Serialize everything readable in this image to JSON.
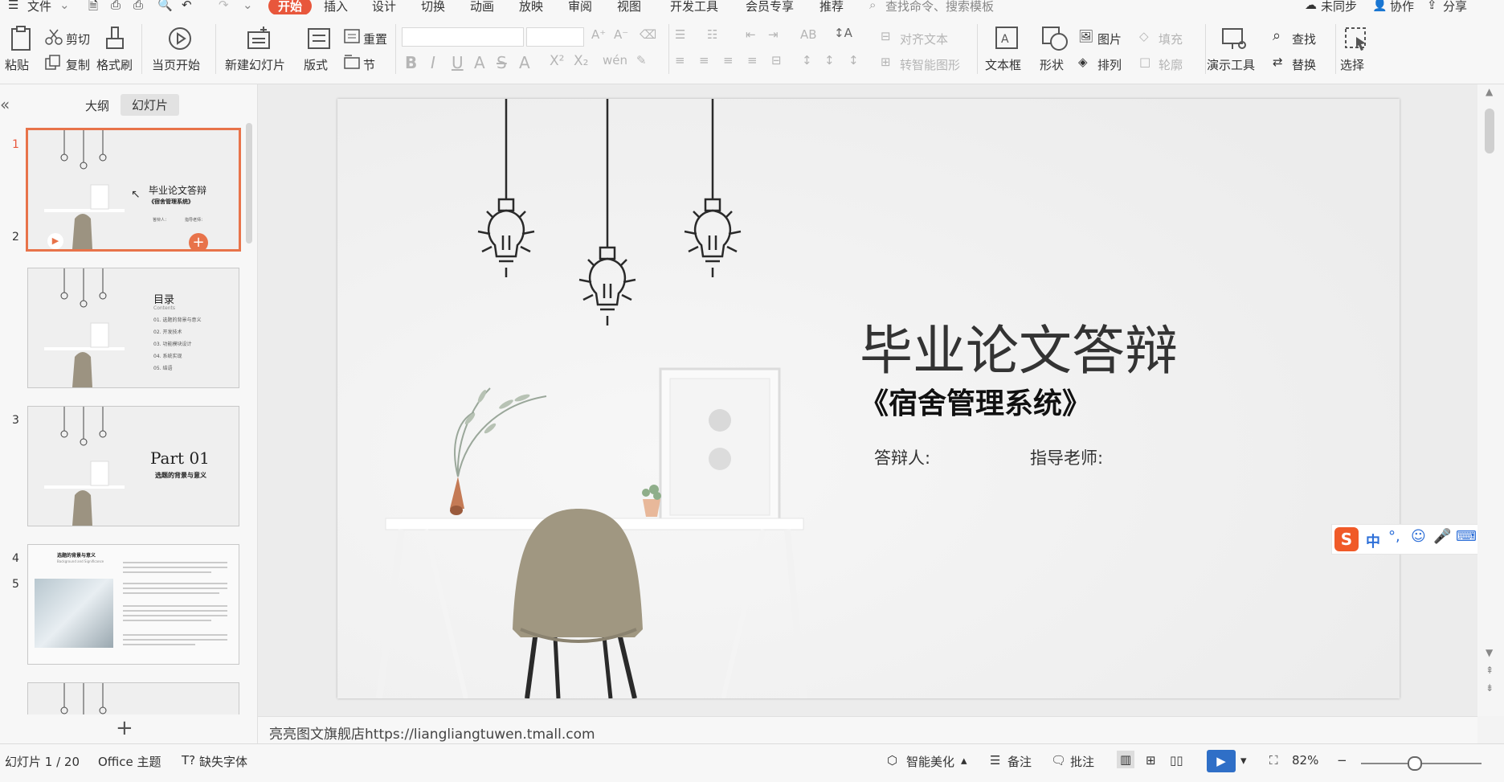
{
  "menubar": {
    "file": "文件",
    "tabs": [
      "开始",
      "插入",
      "设计",
      "切换",
      "动画",
      "放映",
      "审阅",
      "视图",
      "开发工具",
      "会员专享",
      "推荐"
    ],
    "search_placeholder": "查找命令、搜索模板",
    "sync": "未同步",
    "collab": "协作",
    "share": "分享"
  },
  "ribbon": {
    "paste": "粘贴",
    "cut": "剪切",
    "copy": "复制",
    "format_painter": "格式刷",
    "from_current": "当页开始",
    "new_slide": "新建幻灯片",
    "layout": "版式",
    "reset": "重置",
    "section": "节",
    "align_text": "对齐文本",
    "to_smartart": "转智能图形",
    "textbox": "文本框",
    "shape": "形状",
    "picture": "图片",
    "fill": "填充",
    "arrange": "排列",
    "outline": "轮廓",
    "present_tools": "演示工具",
    "find": "查找",
    "replace": "替换",
    "select": "选择"
  },
  "leftpanel": {
    "tab_outline": "大纲",
    "tab_slides": "幻灯片",
    "thumbs": [
      {
        "num": "1",
        "title": "毕业论文答辩",
        "sub": "《宿舍管理系统》",
        "meta1": "答辩人：",
        "meta2": "指导老师："
      },
      {
        "num": "2",
        "title": "目录",
        "sub": "Contents",
        "items": [
          "01. 选题的背景与意义",
          "02. 开发技术",
          "03. 功能模块设计",
          "04. 系统实现",
          "05. 结语"
        ]
      },
      {
        "num": "3",
        "title": "Part 01",
        "sub": "选题的背景与意义"
      },
      {
        "num": "4",
        "title": "选题的背景与意义",
        "sub": "Background and Significance"
      },
      {
        "num": "5"
      }
    ]
  },
  "slide": {
    "title": "毕业论文答辩",
    "subtitle": "《宿舍管理系统》",
    "defender": "答辩人:",
    "advisor": "指导老师:"
  },
  "notes": {
    "text": "亮亮图文旗舰店https://liangliangtuwen.tmall.com"
  },
  "status": {
    "slide_counter": "幻灯片 1 / 20",
    "theme": "Office 主题",
    "missing_font": "缺失字体",
    "beautify": "智能美化",
    "notes": "备注",
    "comments": "批注",
    "zoom": "82%"
  },
  "ime": {
    "lang": "中"
  },
  "colors": {
    "accent": "#e8573c",
    "thumb_select": "#e8734a"
  }
}
